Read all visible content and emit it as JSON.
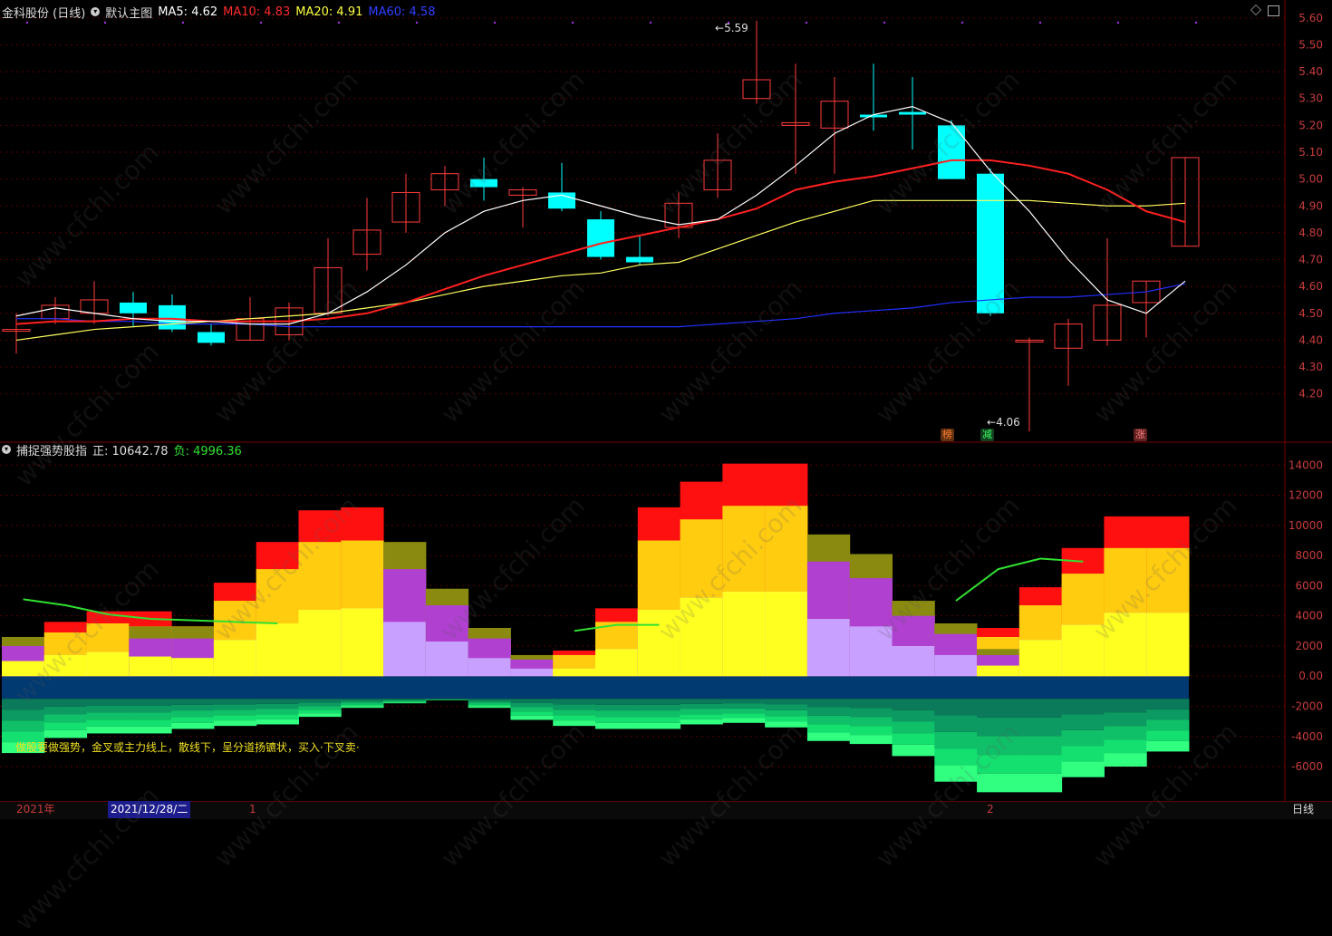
{
  "header_top": {
    "stock": "金科股份 (日线)",
    "main_chart": "默认主图",
    "ma5_label": "MA5: 4.62",
    "ma10_label": "MA10: 4.83",
    "ma20_label": "MA20: 4.91",
    "ma60_label": "MA60: 4.58",
    "diamond_icon": "diamond-icon",
    "window_icon": "window-icon"
  },
  "header_bottom": {
    "indicator": "捕捉强势股指",
    "pos_label": "正: 10642.78",
    "neg_label": "负: 4996.36"
  },
  "annotations": {
    "high": "5.59",
    "low": "4.06",
    "tag1": "榜",
    "tag2": "减",
    "tag3": "涨",
    "note": "做股要做强势，金叉或主力线上，散线下，呈分道扬镳状，买入·下叉卖·"
  },
  "footer": {
    "year": "2021年",
    "cursor_date": "2021/12/28/二",
    "m1": "1",
    "m2": "2",
    "period": "日线"
  },
  "watermark": "www.cfchi.com",
  "colors": {
    "up": "#ff3c3c",
    "down": "#00ffff",
    "ma5": "#ffffff",
    "ma10": "#ff2020",
    "ma20": "#ffff60",
    "ma60": "#2030ff",
    "grid": "#7a0000"
  },
  "chart_data": [
    {
      "type": "candlestick",
      "y_axis_ticks": [
        "5.60",
        "5.50",
        "5.40",
        "5.30",
        "5.20",
        "5.10",
        "5.00",
        "4.90",
        "4.80",
        "4.70",
        "4.60",
        "4.50",
        "4.40",
        "4.30",
        "4.20"
      ],
      "ylim": [
        4.02,
        5.64
      ],
      "candles": [
        {
          "o": 4.44,
          "h": 4.5,
          "l": 4.35,
          "c": 4.44
        },
        {
          "o": 4.48,
          "h": 4.56,
          "l": 4.46,
          "c": 4.53
        },
        {
          "o": 4.5,
          "h": 4.62,
          "l": 4.46,
          "c": 4.55
        },
        {
          "o": 4.54,
          "h": 4.58,
          "l": 4.45,
          "c": 4.5
        },
        {
          "o": 4.53,
          "h": 4.57,
          "l": 4.43,
          "c": 4.44
        },
        {
          "o": 4.43,
          "h": 4.46,
          "l": 4.38,
          "c": 4.39
        },
        {
          "o": 4.4,
          "h": 4.56,
          "l": 4.4,
          "c": 4.48
        },
        {
          "o": 4.42,
          "h": 4.54,
          "l": 4.4,
          "c": 4.52
        },
        {
          "o": 4.5,
          "h": 4.78,
          "l": 4.49,
          "c": 4.67
        },
        {
          "o": 4.72,
          "h": 4.93,
          "l": 4.66,
          "c": 4.81
        },
        {
          "o": 4.84,
          "h": 5.02,
          "l": 4.8,
          "c": 4.95
        },
        {
          "o": 4.96,
          "h": 5.05,
          "l": 4.9,
          "c": 5.02
        },
        {
          "o": 5.0,
          "h": 5.08,
          "l": 4.92,
          "c": 4.97
        },
        {
          "o": 4.94,
          "h": 4.97,
          "l": 4.82,
          "c": 4.96
        },
        {
          "o": 4.95,
          "h": 5.06,
          "l": 4.88,
          "c": 4.89
        },
        {
          "o": 4.85,
          "h": 4.88,
          "l": 4.7,
          "c": 4.71
        },
        {
          "o": 4.71,
          "h": 4.79,
          "l": 4.68,
          "c": 4.69
        },
        {
          "o": 4.82,
          "h": 4.95,
          "l": 4.78,
          "c": 4.91
        },
        {
          "o": 4.96,
          "h": 5.17,
          "l": 4.93,
          "c": 5.07
        },
        {
          "o": 5.3,
          "h": 5.59,
          "l": 5.28,
          "c": 5.37
        },
        {
          "o": 5.2,
          "h": 5.43,
          "l": 5.02,
          "c": 5.21
        },
        {
          "o": 5.19,
          "h": 5.38,
          "l": 5.02,
          "c": 5.29
        },
        {
          "o": 5.24,
          "h": 5.43,
          "l": 5.18,
          "c": 5.23
        },
        {
          "o": 5.25,
          "h": 5.38,
          "l": 5.11,
          "c": 5.24
        },
        {
          "o": 5.2,
          "h": 5.22,
          "l": 5.0,
          "c": 5.0
        },
        {
          "o": 5.02,
          "h": 5.04,
          "l": 4.49,
          "c": 4.5
        },
        {
          "o": 4.4,
          "h": 4.41,
          "l": 4.06,
          "c": 4.4
        },
        {
          "o": 4.37,
          "h": 4.48,
          "l": 4.23,
          "c": 4.46
        },
        {
          "o": 4.4,
          "h": 4.78,
          "l": 4.38,
          "c": 4.53
        },
        {
          "o": 4.54,
          "h": 4.62,
          "l": 4.41,
          "c": 4.62
        },
        {
          "o": 4.75,
          "h": 5.08,
          "l": 4.75,
          "c": 5.08
        }
      ],
      "ma5": [
        4.49,
        4.52,
        4.5,
        4.48,
        4.47,
        4.47,
        4.46,
        4.46,
        4.5,
        4.58,
        4.68,
        4.8,
        4.88,
        4.92,
        4.94,
        4.9,
        4.86,
        4.83,
        4.85,
        4.94,
        5.05,
        5.17,
        5.24,
        5.27,
        5.21,
        5.03,
        4.88,
        4.7,
        4.55,
        4.5,
        4.62
      ],
      "ma10": [
        4.46,
        4.47,
        4.47,
        4.48,
        4.48,
        4.47,
        4.47,
        4.47,
        4.48,
        4.5,
        4.54,
        4.59,
        4.64,
        4.68,
        4.72,
        4.76,
        4.79,
        4.82,
        4.85,
        4.89,
        4.96,
        4.99,
        5.01,
        5.04,
        5.07,
        5.07,
        5.05,
        5.02,
        4.96,
        4.88,
        4.84
      ],
      "ma20": [
        4.4,
        4.42,
        4.44,
        4.45,
        4.46,
        4.47,
        4.48,
        4.49,
        4.5,
        4.52,
        4.54,
        4.57,
        4.6,
        4.62,
        4.64,
        4.65,
        4.68,
        4.69,
        4.74,
        4.79,
        4.84,
        4.88,
        4.92,
        4.92,
        4.92,
        4.92,
        4.92,
        4.91,
        4.9,
        4.9,
        4.91
      ],
      "ma60": [
        4.48,
        4.48,
        4.47,
        4.47,
        4.46,
        4.46,
        4.46,
        4.45,
        4.45,
        4.45,
        4.45,
        4.45,
        4.45,
        4.45,
        4.45,
        4.45,
        4.45,
        4.45,
        4.46,
        4.47,
        4.48,
        4.5,
        4.51,
        4.52,
        4.54,
        4.55,
        4.56,
        4.56,
        4.57,
        4.58,
        4.61
      ]
    },
    {
      "type": "stacked_bar",
      "y_axis_ticks": [
        "14000",
        "12000",
        "10000",
        "8000",
        "6000",
        "4000",
        "2000",
        "0.00",
        "-2000",
        "-4000",
        "-6000"
      ],
      "ylim": [
        -7800,
        14800
      ],
      "positive": [
        {
          "red": 2200,
          "gold": 2200,
          "olive": 2600,
          "violet": 2000,
          "lilac": 1000
        },
        {
          "red": 3600,
          "gold": 2900,
          "olive": 0,
          "violet": 0,
          "lilac": 1400
        },
        {
          "red": 4300,
          "gold": 3500,
          "olive": 0,
          "violet": 0,
          "lilac": 1600
        },
        {
          "red": 4300,
          "gold": 3300,
          "olive": 3300,
          "violet": 2500,
          "lilac": 1300
        },
        {
          "red": 3300,
          "gold": 3300,
          "olive": 3300,
          "violet": 2500,
          "lilac": 1200
        },
        {
          "red": 6200,
          "gold": 5000,
          "olive": 0,
          "violet": 0,
          "lilac": 2400
        },
        {
          "red": 8900,
          "gold": 7100,
          "olive": 0,
          "violet": 0,
          "lilac": 3500
        },
        {
          "red": 11000,
          "gold": 8900,
          "olive": 0,
          "violet": 0,
          "lilac": 4400
        },
        {
          "red": 11200,
          "gold": 9000,
          "olive": 0,
          "violet": 0,
          "lilac": 4500
        },
        {
          "red": 0,
          "gold": 0,
          "olive": 8900,
          "violet": 7100,
          "lilac": 3600
        },
        {
          "red": 0,
          "gold": 0,
          "olive": 5800,
          "violet": 4700,
          "lilac": 2300
        },
        {
          "red": 0,
          "gold": 0,
          "olive": 3200,
          "violet": 2500,
          "lilac": 1200
        },
        {
          "red": 0,
          "gold": 0,
          "olive": 1400,
          "violet": 1100,
          "lilac": 500
        },
        {
          "red": 1700,
          "gold": 1400,
          "olive": 0,
          "violet": 0,
          "lilac": 500
        },
        {
          "red": 4500,
          "gold": 3600,
          "olive": 0,
          "violet": 0,
          "lilac": 1800
        },
        {
          "red": 11200,
          "gold": 9000,
          "olive": 0,
          "violet": 0,
          "lilac": 4400
        },
        {
          "red": 12900,
          "gold": 10400,
          "olive": 0,
          "violet": 0,
          "lilac": 5200
        },
        {
          "red": 14100,
          "gold": 11300,
          "olive": 0,
          "violet": 0,
          "lilac": 5600
        },
        {
          "red": 14100,
          "gold": 11300,
          "olive": 0,
          "violet": 0,
          "lilac": 5600
        },
        {
          "red": 0,
          "gold": 0,
          "olive": 9400,
          "violet": 7600,
          "lilac": 3800
        },
        {
          "red": 0,
          "gold": 0,
          "olive": 8100,
          "violet": 6500,
          "lilac": 3300
        },
        {
          "red": 0,
          "gold": 0,
          "olive": 5000,
          "violet": 4000,
          "lilac": 2000
        },
        {
          "red": 0,
          "gold": 0,
          "olive": 3500,
          "violet": 2800,
          "lilac": 1400
        },
        {
          "red": 3200,
          "gold": 2600,
          "olive": 1800,
          "violet": 1400,
          "lilac": 700
        },
        {
          "red": 5900,
          "gold": 4700,
          "olive": 0,
          "violet": 0,
          "lilac": 2400
        },
        {
          "red": 8500,
          "gold": 6800,
          "olive": 0,
          "violet": 0,
          "lilac": 3400
        },
        {
          "red": 10600,
          "gold": 8500,
          "olive": 0,
          "violet": 0,
          "lilac": 4200
        },
        {
          "red": 10600,
          "gold": 8500,
          "olive": 0,
          "violet": 0,
          "lilac": 4200
        }
      ],
      "negative": [
        -5100,
        -4100,
        -3800,
        -3800,
        -3500,
        -3300,
        -3200,
        -2700,
        -2100,
        -1800,
        -1600,
        -2100,
        -2900,
        -3300,
        -3500,
        -3500,
        -3200,
        -3100,
        -3400,
        -4300,
        -4500,
        -5300,
        -7000,
        -7700,
        -7700,
        -6700,
        -6000,
        -5000
      ],
      "green_line": [
        5100,
        4700,
        4100,
        3800,
        3700,
        3600,
        3500,
        0,
        0,
        0,
        0,
        0,
        0,
        3000,
        3400,
        3400,
        0,
        0,
        0,
        0,
        0,
        0,
        5000,
        7100,
        7800,
        7600,
        0,
        0
      ]
    }
  ]
}
